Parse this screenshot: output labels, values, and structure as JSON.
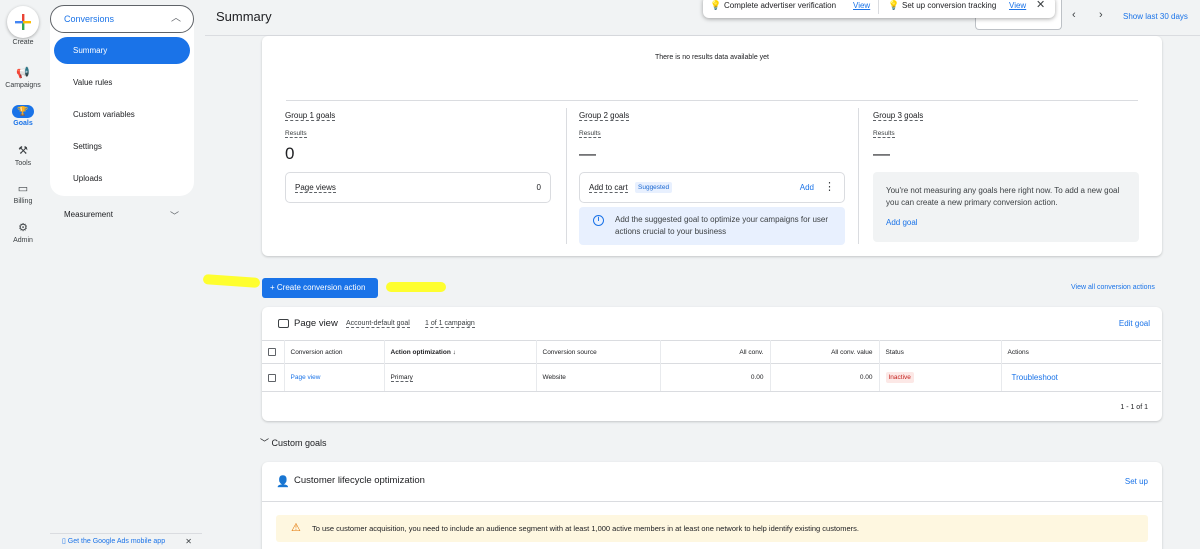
{
  "rail": {
    "create": "Create",
    "items": [
      {
        "label": "Campaigns",
        "icon": "megaphone-icon"
      },
      {
        "label": "Goals",
        "icon": "trophy-icon"
      },
      {
        "label": "Tools",
        "icon": "tools-icon"
      },
      {
        "label": "Billing",
        "icon": "credit-card-icon"
      },
      {
        "label": "Admin",
        "icon": "gear-icon"
      }
    ]
  },
  "nav": {
    "section": "Conversions",
    "items": [
      "Summary",
      "Value rules",
      "Custom variables",
      "Settings",
      "Uploads"
    ],
    "active": "Summary",
    "measurement": "Measurement",
    "app_promo": "Get the Google Ads mobile app"
  },
  "header": {
    "title": "Summary",
    "show_last": "Show last 30 days"
  },
  "toast": {
    "item1_text": "Complete advertiser verification",
    "item1_link": "View",
    "item2_text": "Set up conversion tracking",
    "item2_link": "View"
  },
  "summary": {
    "no_results": "There is no results data available yet",
    "group1": {
      "title": "Group 1 goals",
      "results_label": "Results",
      "results": "0",
      "goal": "Page views",
      "goal_value": "0"
    },
    "group2": {
      "title": "Group 2 goals",
      "results_label": "Results",
      "results": "—",
      "goal": "Add to cart",
      "badge": "Suggested",
      "add": "Add",
      "info": "Add the suggested goal to optimize your campaigns for user actions crucial to your business"
    },
    "group3": {
      "title": "Group 3 goals",
      "results_label": "Results",
      "results": "—",
      "message": "You're not measuring any goals here right now. To add a new goal you can create a new primary conversion action.",
      "add_goal": "Add goal"
    }
  },
  "actions": {
    "create": "+ Create conversion action",
    "view_all": "View all conversion actions"
  },
  "page_view": {
    "title": "Page view",
    "default_goal": "Account-default goal",
    "campaigns": "1 of 1 campaign",
    "edit_goal": "Edit goal",
    "columns": [
      "Conversion action",
      "Action optimization ↓",
      "Conversion source",
      "All conv.",
      "All conv. value",
      "Status",
      "Actions"
    ],
    "row": {
      "action": "Page view",
      "optimization": "Primary",
      "source": "Website",
      "all_conv": "0.00",
      "all_conv_value": "0.00",
      "status": "Inactive",
      "actions": "Troubleshoot"
    },
    "pager": "1 - 1 of 1"
  },
  "custom_goals": "Custom goals",
  "lifecycle": {
    "title": "Customer lifecycle optimization",
    "setup": "Set up",
    "warning": "To use customer acquisition, you need to include an audience segment with at least 1,000 active members in at least one network to help identify existing customers."
  },
  "colors": {
    "accent": "#1a73e8",
    "highlight": "#ffff1a",
    "inactive": "#c5221f"
  }
}
